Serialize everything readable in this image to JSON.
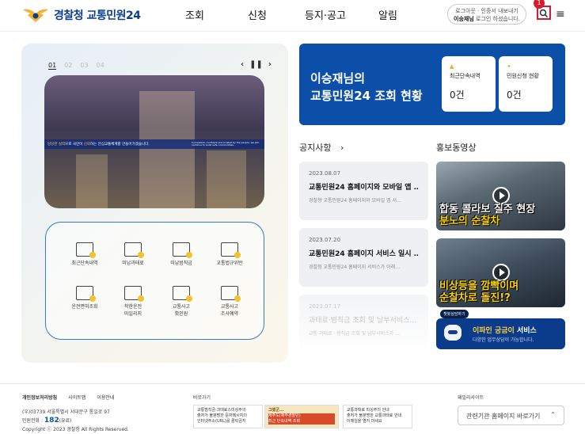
{
  "header": {
    "logo_text": "경찰청 교통민원24",
    "nav": [
      "조회",
      "신청",
      "등지·공고",
      "알림"
    ],
    "login_line1": "로그아웃 · 인증서 내보내기",
    "login_name": "이승재님",
    "login_line2": " 로그인 하셨습니다.",
    "search_badge": "1",
    "menu_icon": "≡"
  },
  "slider": {
    "numbers": [
      "01",
      "02",
      "03",
      "04"
    ],
    "prev": "‹",
    "pause": "❚❚",
    "next": "›",
    "banner_left_pre": "당당한 실력",
    "banner_left_mid": "으로 국민이 ",
    "banner_left_hl": "신뢰",
    "banner_left_post": "하는 안심교통체계를 만들어가겠습니다.",
    "banner_right": "Competent, confident and trusted by the people, we will continue to build safe communities."
  },
  "services": [
    {
      "label": "최근단속내역"
    },
    {
      "label": "미납과태료"
    },
    {
      "label": "미납범칙금"
    },
    {
      "label": "교통법규위반"
    },
    {
      "label": "운전면허조회"
    },
    {
      "label": "착한운전\n마일리지"
    },
    {
      "label": "교통사고\n확인원"
    },
    {
      "label": "교통사고\n조사예약"
    }
  ],
  "status": {
    "title_line1": "이승재님의",
    "title_line2": "교통민원24 조회 현황",
    "cards": [
      {
        "icon": "▲",
        "label": "최근단속내역",
        "value": "0건"
      },
      {
        "icon": "✦",
        "label": "민원신청 현황",
        "value": "0건"
      }
    ]
  },
  "notices": {
    "title": "공지사항",
    "arrow": "›",
    "items": [
      {
        "date": "2023.08.07",
        "title": "교통민원24 홈페이지와 모바일 앱 …",
        "desc": "경찰청 교통민원24 홈페이지와 모바일 앱 서…"
      },
      {
        "date": "2023.07.20",
        "title": "교통민원24 홈페이지 서비스 일시 …",
        "desc": "경찰청 교통민원24 홈페이지 서비스가 아래…"
      },
      {
        "date": "2023.07.17",
        "title": "과태료·범칙금 조회 및 납부서비스…",
        "desc": "교통 과태료 · 범칙금 조회 및 납부서비스가 …"
      }
    ]
  },
  "videos": {
    "title": "홍보동영상",
    "items": [
      {
        "cap1": "합동 콜라보 질주 현장",
        "cap2": "분노의 순찰차"
      },
      {
        "cap1": "비상등을 깜빡이며",
        "cap2": "순찰차로 돌진!?"
      }
    ]
  },
  "chatbot": {
    "badge": "챗봇상담하기",
    "title_hl": "이파인 궁금이",
    "title_rest": " 서비스",
    "sub": "다양한 업무상담이 가능합니다."
  },
  "footer": {
    "links": [
      "개인정보처리방침",
      "사이트맵",
      "이용안내"
    ],
    "address": "(우)03739 서울특별시 서대문구 통일로 97",
    "phone_label": "민원전화 : ",
    "phone": "182",
    "phone_suffix": "(유료)",
    "copyright": "Copyright ⓒ 2023 경찰청 All Rights Reserved.",
    "shortcut_label": "바로가기",
    "banners": [
      {
        "l1": "교통범칙금·과태료스미싱주의",
        "l2": "출처가 불분명한 문자메시지의",
        "l3": "인터넷주소(URL)를 클릭금지"
      },
      {
        "l1": "그랬군...",
        "l2": "제주도(제주경찰단)",
        "l3": "최근 단속내역 조회"
      },
      {
        "l1": "교통과태료 피싱주의 안내",
        "l2": "출처가 불분명한 교통과태료 안내",
        "l3": "이메일을 열지 마세요"
      }
    ],
    "family_label": "패밀리사이트",
    "family_select": "관련기관 홈페이지 바로가기",
    "family_arrow": "⌃"
  }
}
